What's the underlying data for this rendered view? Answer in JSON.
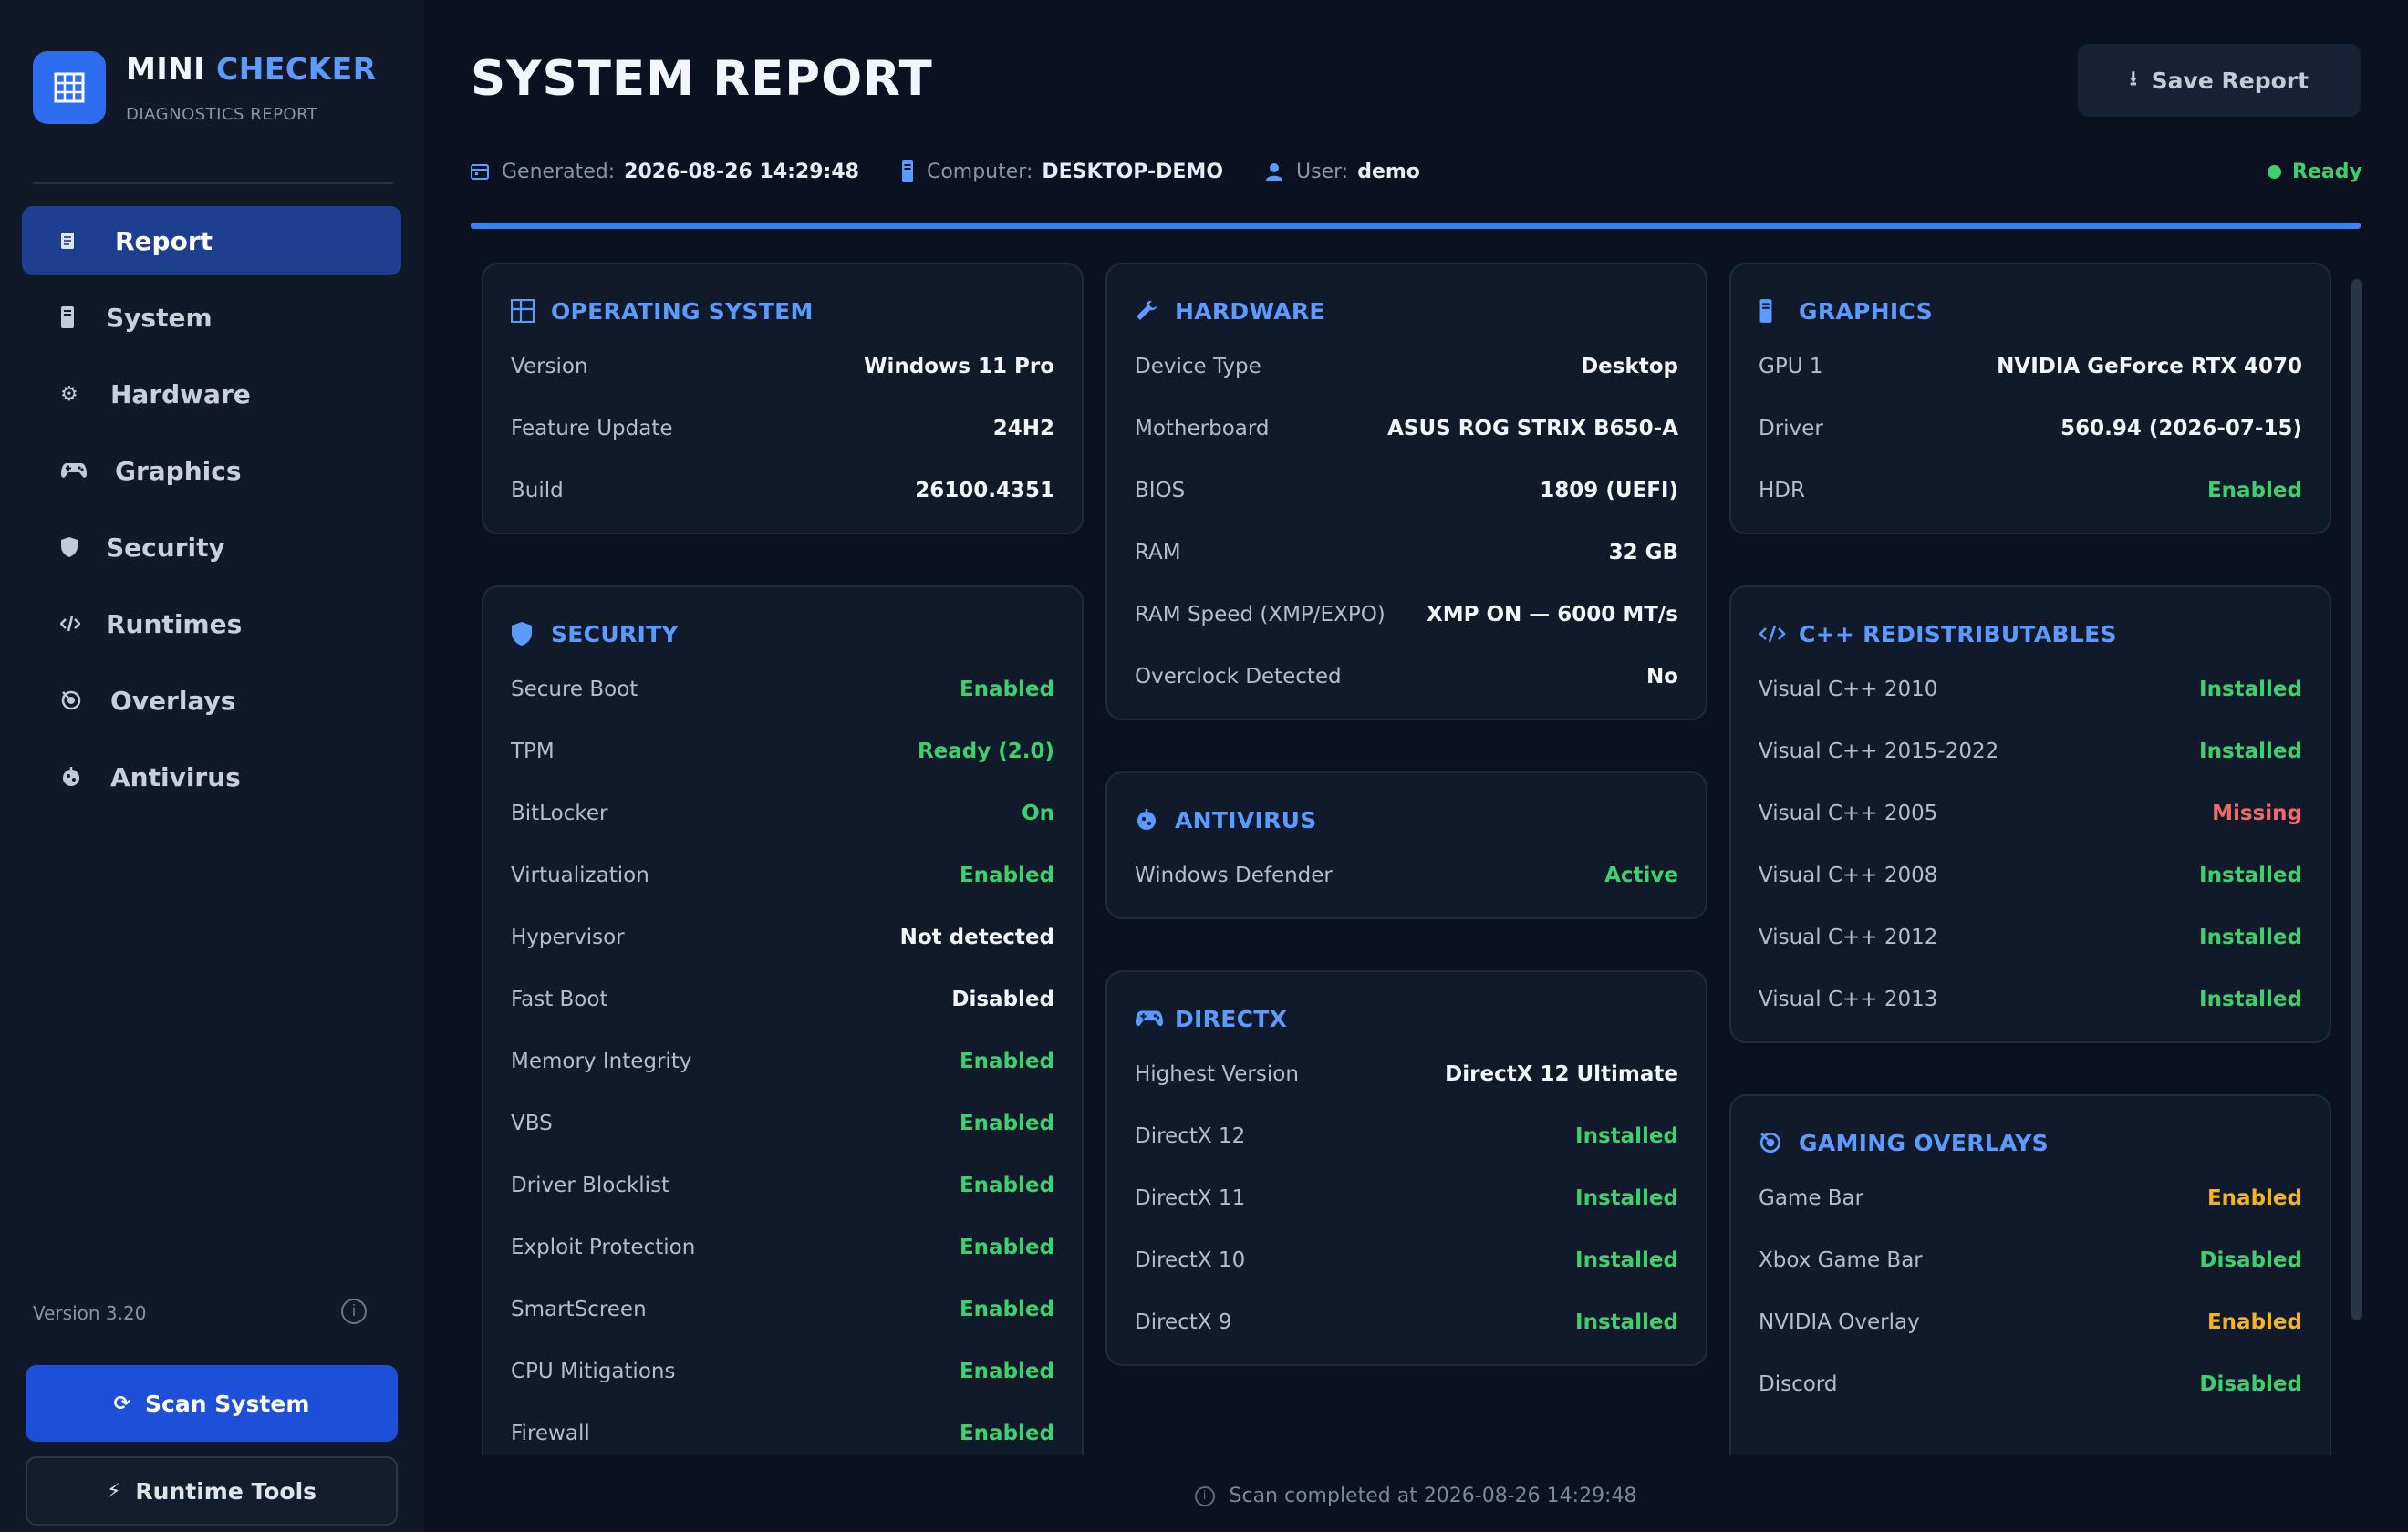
{
  "brand": {
    "title_main": "MINI",
    "title_accent": "CHECKER",
    "subtitle": "DIAGNOSTICS REPORT"
  },
  "nav": {
    "items": [
      {
        "label": "Report",
        "icon": "report-icon",
        "active": true
      },
      {
        "label": "System",
        "icon": "system-icon"
      },
      {
        "label": "Hardware",
        "icon": "hardware-icon"
      },
      {
        "label": "Graphics",
        "icon": "gamepad-icon"
      },
      {
        "label": "Security",
        "icon": "shield-icon"
      },
      {
        "label": "Runtimes",
        "icon": "runtimes-icon"
      },
      {
        "label": "Overlays",
        "icon": "overlays-icon"
      },
      {
        "label": "Antivirus",
        "icon": "antivirus-icon"
      }
    ]
  },
  "version": "Version 3.20",
  "buttons": {
    "scan": "Scan System",
    "runtime_tools": "Runtime Tools",
    "save_report": "Save Report"
  },
  "header": {
    "title": "SYSTEM REPORT",
    "generated_label": "Generated:",
    "generated_value": "2026-08-26 14:29:48",
    "computer_label": "Computer:",
    "computer_value": "DESKTOP-DEMO",
    "user_label": "User:",
    "user_value": "demo",
    "status": "Ready",
    "progress": 1.0
  },
  "colors": {
    "accent": "#5b9bff",
    "ok": "#3ecf6e",
    "error": "#f16a6a",
    "warn": "#f5b324",
    "primary_button": "#1d4fd8"
  },
  "cards": {
    "os": {
      "title": "OPERATING SYSTEM",
      "rows": [
        {
          "k": "Version",
          "v": "Windows 11 Pro"
        },
        {
          "k": "Feature Update",
          "v": "24H2"
        },
        {
          "k": "Build",
          "v": "26100.4351"
        }
      ]
    },
    "security": {
      "title": "SECURITY",
      "rows": [
        {
          "k": "Secure Boot",
          "v": "Enabled",
          "s": "green"
        },
        {
          "k": "TPM",
          "v": "Ready (2.0)",
          "s": "green"
        },
        {
          "k": "BitLocker",
          "v": "On",
          "s": "green"
        },
        {
          "k": "Virtualization",
          "v": "Enabled",
          "s": "green"
        },
        {
          "k": "Hypervisor",
          "v": "Not detected"
        },
        {
          "k": "Fast Boot",
          "v": "Disabled"
        },
        {
          "k": "Memory Integrity",
          "v": "Enabled",
          "s": "green"
        },
        {
          "k": "VBS",
          "v": "Enabled",
          "s": "green"
        },
        {
          "k": "Driver Blocklist",
          "v": "Enabled",
          "s": "green"
        },
        {
          "k": "Exploit Protection",
          "v": "Enabled",
          "s": "green"
        },
        {
          "k": "SmartScreen",
          "v": "Enabled",
          "s": "green"
        },
        {
          "k": "CPU Mitigations",
          "v": "Enabled",
          "s": "green"
        },
        {
          "k": "Firewall",
          "v": "Enabled",
          "s": "green"
        }
      ]
    },
    "hardware": {
      "title": "HARDWARE",
      "rows": [
        {
          "k": "Device Type",
          "v": "Desktop"
        },
        {
          "k": "Motherboard",
          "v": "ASUS ROG STRIX B650-A"
        },
        {
          "k": "BIOS",
          "v": "1809  (UEFI)"
        },
        {
          "k": "RAM",
          "v": "32 GB"
        },
        {
          "k": "RAM Speed (XMP/EXPO)",
          "v": "XMP ON — 6000 MT/s"
        },
        {
          "k": "Overclock Detected",
          "v": "No"
        }
      ]
    },
    "antivirus": {
      "title": "ANTIVIRUS",
      "rows": [
        {
          "k": "Windows Defender",
          "v": "Active",
          "s": "green"
        }
      ]
    },
    "directx": {
      "title": "DIRECTX",
      "rows": [
        {
          "k": "Highest Version",
          "v": "DirectX 12 Ultimate"
        },
        {
          "k": "DirectX 12",
          "v": "Installed",
          "s": "green"
        },
        {
          "k": "DirectX 11",
          "v": "Installed",
          "s": "green"
        },
        {
          "k": "DirectX 10",
          "v": "Installed",
          "s": "green"
        },
        {
          "k": "DirectX 9",
          "v": "Installed",
          "s": "green"
        }
      ]
    },
    "graphics": {
      "title": "GRAPHICS",
      "rows": [
        {
          "k": "GPU 1",
          "v": "NVIDIA GeForce RTX 4070"
        },
        {
          "k": "Driver",
          "v": "560.94  (2026-07-15)"
        },
        {
          "k": "HDR",
          "v": "Enabled",
          "s": "green"
        }
      ]
    },
    "cpp": {
      "title": "C++ REDISTRIBUTABLES",
      "rows": [
        {
          "k": "Visual C++ 2010",
          "v": "Installed",
          "s": "green"
        },
        {
          "k": "Visual C++ 2015-2022",
          "v": "Installed",
          "s": "green"
        },
        {
          "k": "Visual C++ 2005",
          "v": "Missing",
          "s": "red"
        },
        {
          "k": "Visual C++ 2008",
          "v": "Installed",
          "s": "green"
        },
        {
          "k": "Visual C++ 2012",
          "v": "Installed",
          "s": "green"
        },
        {
          "k": "Visual C++ 2013",
          "v": "Installed",
          "s": "green"
        }
      ]
    },
    "overlays": {
      "title": "GAMING OVERLAYS",
      "rows": [
        {
          "k": "Game Bar",
          "v": "Enabled",
          "s": "amber"
        },
        {
          "k": "Xbox Game Bar",
          "v": "Disabled",
          "s": "green"
        },
        {
          "k": "NVIDIA Overlay",
          "v": "Enabled",
          "s": "amber"
        },
        {
          "k": "Discord",
          "v": "Disabled",
          "s": "green"
        }
      ]
    }
  },
  "footer": {
    "text": "Scan completed at 2026-08-26 14:29:48"
  }
}
